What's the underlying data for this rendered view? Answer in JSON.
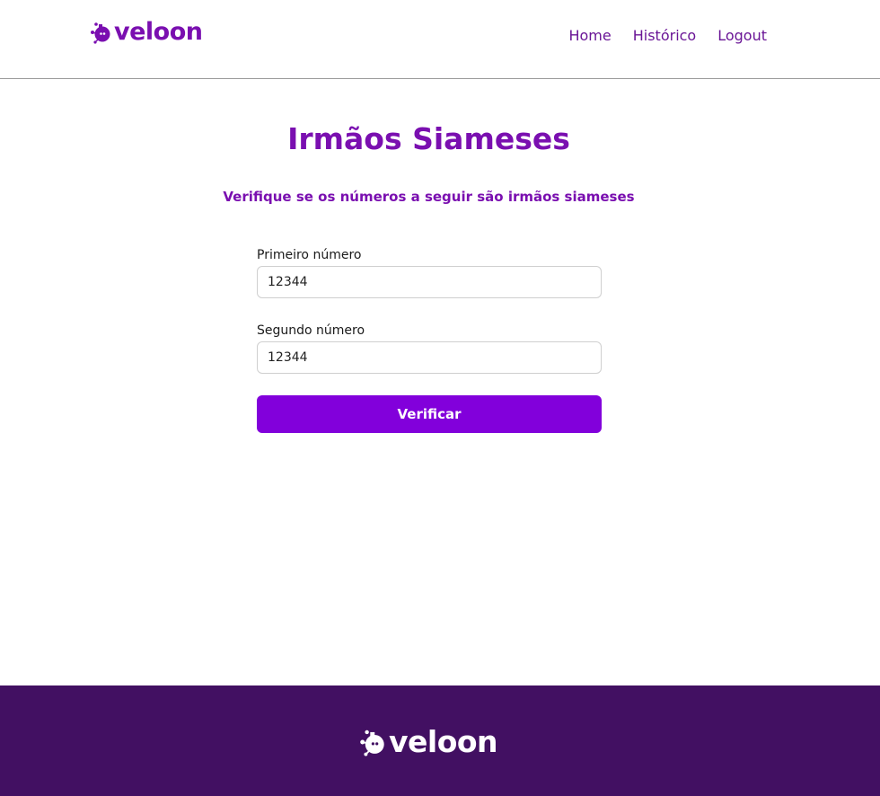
{
  "brand": {
    "name": "veloon",
    "color": "#7a0fb0",
    "button_color": "#8200db",
    "footer_bg": "#421062"
  },
  "nav": {
    "items": [
      {
        "label": "Home"
      },
      {
        "label": "Histórico"
      },
      {
        "label": "Logout"
      }
    ]
  },
  "main": {
    "title": "Irmãos Siameses",
    "subtitle": "Verifique se os números a seguir são irmãos siameses",
    "first_label": "Primeiro número",
    "first_value": "12344",
    "second_label": "Segundo número",
    "second_value": "12344",
    "submit_label": "Verificar"
  },
  "footer": {
    "brand": "veloon"
  }
}
